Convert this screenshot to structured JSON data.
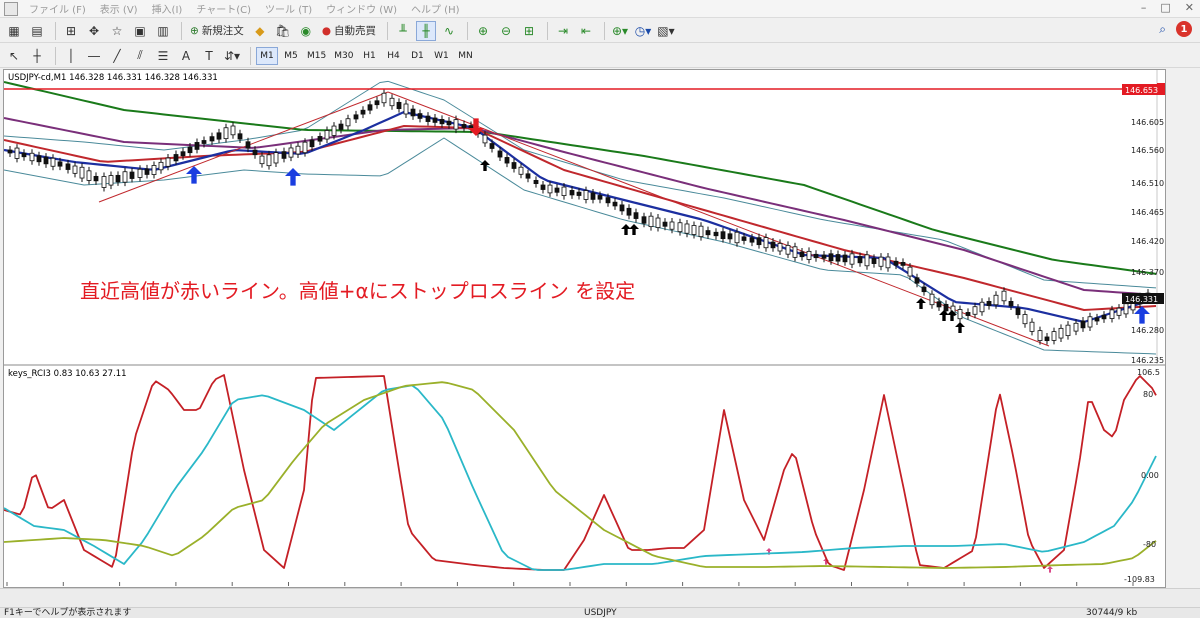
{
  "menu": {
    "items": [
      "ファイル (F)",
      "表示 (V)",
      "挿入(I)",
      "チャート(C)",
      "ツール (T)",
      "ウィンドウ (W)",
      "ヘルプ (H)"
    ],
    "window_controls": [
      "–",
      "□",
      "✕"
    ]
  },
  "toolbar": {
    "new_order_label": "新規注文",
    "auto_trade_label": "自動売買",
    "timeframes": [
      "M1",
      "M5",
      "M15",
      "M30",
      "H1",
      "H4",
      "D1",
      "W1",
      "MN"
    ],
    "active_timeframe": "M1",
    "notification_count": "1"
  },
  "chart": {
    "symbol_header": "USDJPY-cd,M1  146.328 146.331 146.328 146.331",
    "annotation": "直近高値が赤いライン。高値+αにストップロスライン を設定",
    "price_line_label": "146.653",
    "current_price_label": "146.331",
    "price_axis": [
      "146.605",
      "146.560",
      "146.510",
      "146.465",
      "146.420",
      "146.370",
      "146.280",
      "146.235"
    ],
    "indicator_header": "keys_RCI3 0.83 10.63 27.11",
    "indicator_axis": [
      "106.5",
      "80",
      "0.00",
      "-80",
      "-109.83"
    ],
    "time_axis": [
      "16 Sep 2025",
      "16 Sep 17:55",
      "16 Sep 18:03",
      "16 Sep 18:11",
      "16 Sep 18:19",
      "16 Sep 18:27",
      "16 Sep 18:35",
      "16 Sep 18:43",
      "16 Sep 18:51",
      "16 Sep 18:59",
      "16 Sep 19:07",
      "16 Sep 19:15",
      "16 Sep 19:23",
      "16 Sep 19:31",
      "16 Sep 19:39",
      "16 Sep 19:47",
      "16 Sep 19:55",
      "16 Sep 20:03",
      "16 Sep 20:11",
      "16 Sep 20:19",
      "16 Sep 20:27"
    ],
    "colors": {
      "price_line": "#e31b23",
      "annotation": "#e31b23",
      "ma_green": "#1a7a1a",
      "ma_purple": "#7a2f7a",
      "ma_red": "#c0282d",
      "ma_blue": "#1c2fa0",
      "bollinger": "#4a8a9a",
      "rci_red": "#c42026",
      "rci_cyan": "#2ab8c8",
      "rci_olive": "#9ab02a",
      "arrow_up_blue": "#1a3ee0",
      "arrow_down_red": "#e31b23"
    }
  },
  "status": {
    "help_text": "F1キーでヘルプが表示されます",
    "symbol": "USDJPY",
    "traffic": "30744/9 kb"
  }
}
